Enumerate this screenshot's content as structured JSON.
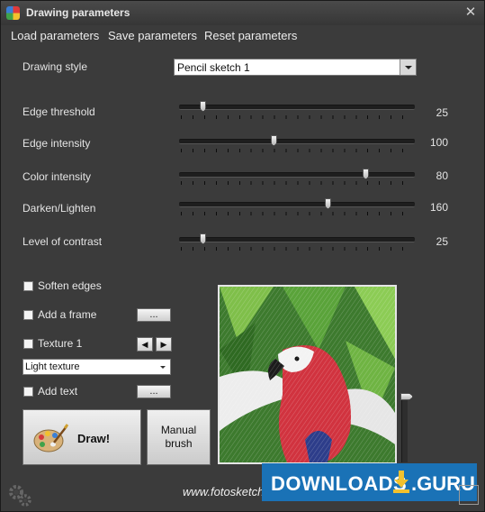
{
  "window": {
    "title": "Drawing parameters",
    "close_icon": "close-icon"
  },
  "menu": {
    "load": "Load parameters",
    "save": "Save parameters",
    "reset": "Reset parameters"
  },
  "style": {
    "label": "Drawing style",
    "value": "Pencil sketch 1"
  },
  "sliders": [
    {
      "label": "Edge threshold",
      "value": "25",
      "position": 0.1
    },
    {
      "label": "Edge intensity",
      "value": "100",
      "position": 0.4
    },
    {
      "label": "Color intensity",
      "value": "80",
      "position": 0.79
    },
    {
      "label": "Darken/Lighten",
      "value": "160",
      "position": 0.63
    },
    {
      "label": "Level of contrast",
      "value": "25",
      "position": 0.1
    }
  ],
  "options": {
    "soften": "Soften edges",
    "frame": "Add a frame",
    "frame_btn": "...",
    "texture": "Texture 1",
    "texture_value": "Light texture",
    "text": "Add text",
    "text_btn": "..."
  },
  "buttons": {
    "draw": "Draw!",
    "manual": "Manual brush"
  },
  "footer": {
    "url": "www.fotosketcher.com"
  },
  "watermark": {
    "part1": "DOWNLOADS",
    "part2": ".GURU"
  },
  "colors": {
    "window_bg": "#3b3b3b",
    "watermark_bg": "#1a72b6",
    "accent_yellow": "#f2c12e"
  }
}
